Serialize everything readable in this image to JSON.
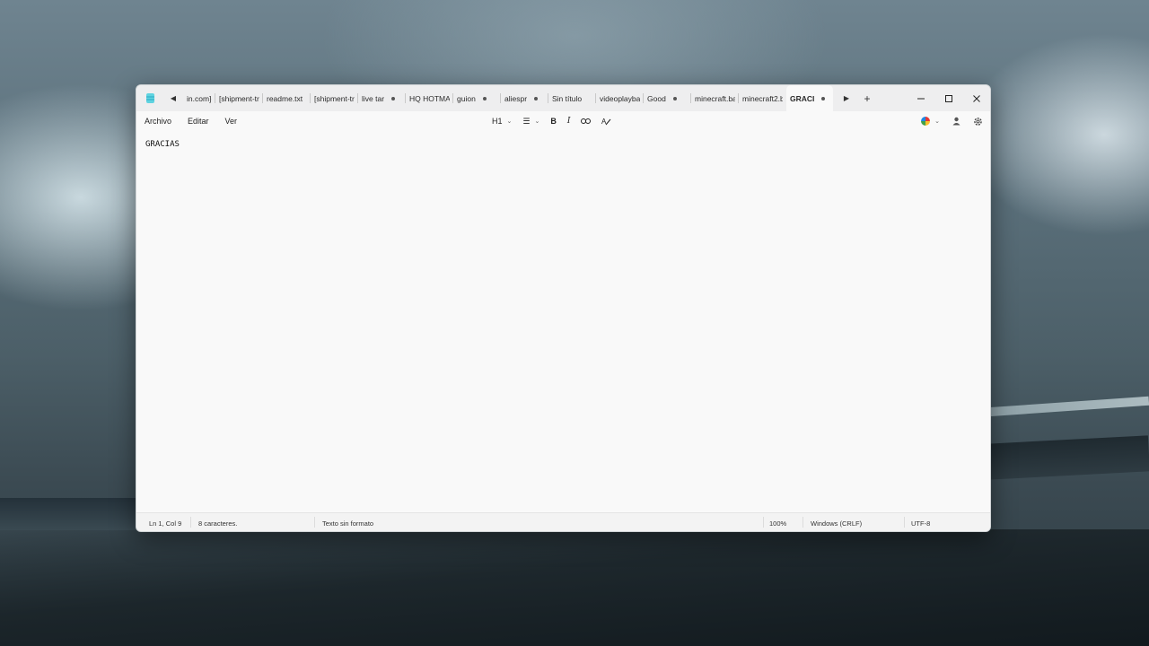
{
  "window": {
    "tabs": [
      {
        "label": "in.com](",
        "modified": false
      },
      {
        "label": "[shipment-tr",
        "modified": false
      },
      {
        "label": "readme.txt",
        "modified": false
      },
      {
        "label": "[shipment-tr",
        "modified": false
      },
      {
        "label": "live tar",
        "modified": true
      },
      {
        "label": "HQ HOTMAI",
        "modified": false
      },
      {
        "label": "guion",
        "modified": true
      },
      {
        "label": "aliespr",
        "modified": true
      },
      {
        "label": "Sin título",
        "modified": false
      },
      {
        "label": "videoplayba",
        "modified": false
      },
      {
        "label": "Good",
        "modified": true
      },
      {
        "label": "minecraft.ba",
        "modified": false
      },
      {
        "label": "minecraft2.b",
        "modified": false
      },
      {
        "label": "GRACI",
        "modified": true,
        "active": true
      }
    ],
    "new_tab": "+",
    "scroll_left": "◀",
    "scroll_right": "▶"
  },
  "menu": {
    "file": "Archivo",
    "edit": "Editar",
    "view": "Ver"
  },
  "format": {
    "heading": "H1",
    "list": "☰",
    "bold": "B",
    "italic": "I"
  },
  "editor": {
    "content": "GRACIAS"
  },
  "status": {
    "position": "Ln 1, Col 9",
    "chars": "8 caracteres.",
    "format": "Texto sin formato",
    "zoom": "100%",
    "line_endings": "Windows (CRLF)",
    "encoding": "UTF-8"
  }
}
